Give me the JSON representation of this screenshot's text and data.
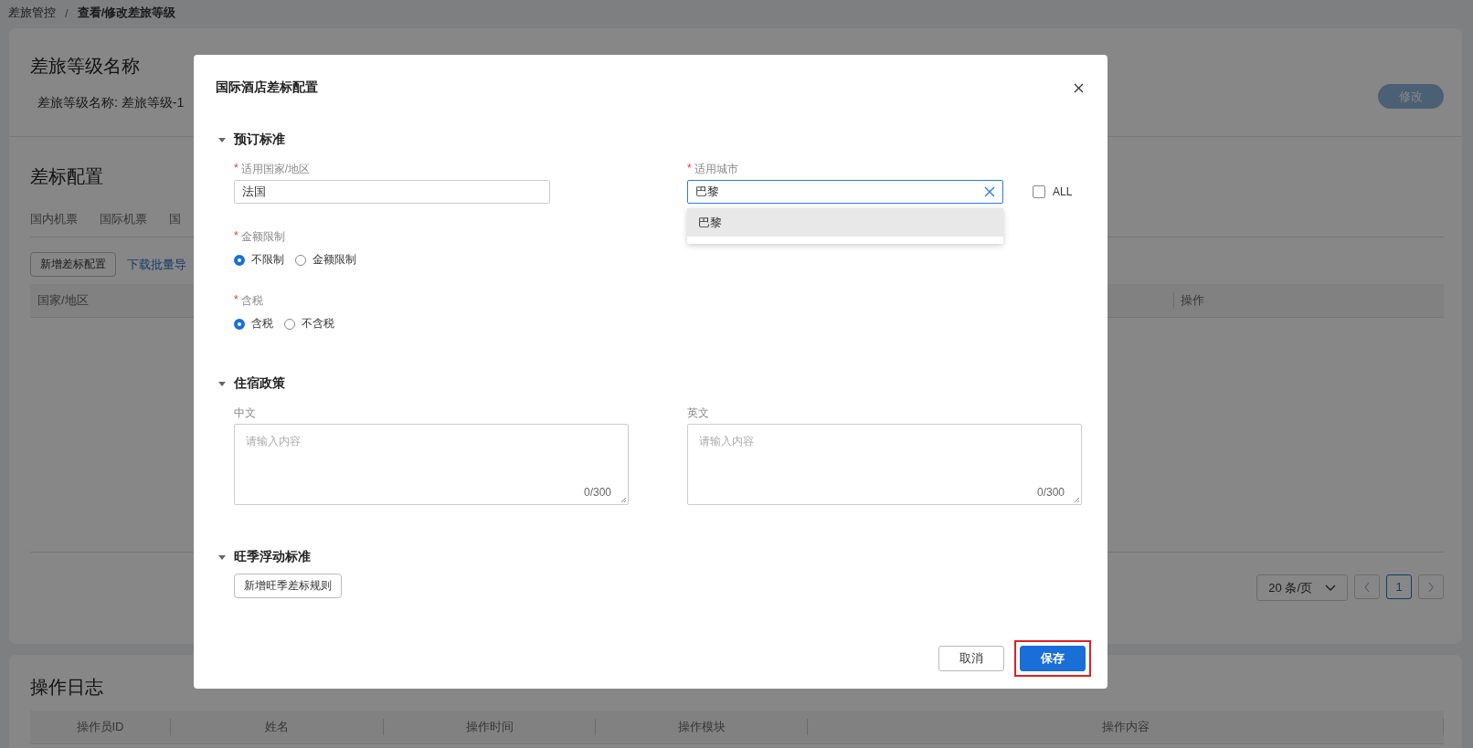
{
  "breadcrumb": {
    "items": [
      "差旅管控",
      "查看/修改差旅等级"
    ],
    "separator": "/"
  },
  "level_card": {
    "title": "差旅等级名称",
    "name_line": "差旅等级名称: 差旅等级-1",
    "edit_button": "修改"
  },
  "config": {
    "title": "差标配置",
    "tabs": [
      "国内机票",
      "国际机票",
      "国"
    ],
    "add_button": "新增差标配置",
    "import_link": "下载批量导",
    "table_columns": [
      "国家/地区",
      "操作"
    ],
    "pagination": {
      "page_size": "20 条/页",
      "pages": [
        {
          "label": "1",
          "selected": true
        }
      ]
    }
  },
  "log": {
    "title": "操作日志",
    "columns": [
      "操作员ID",
      "姓名",
      "操作时间",
      "操作模块",
      "操作内容"
    ]
  },
  "dialog": {
    "title": "国际酒店差标配置",
    "required_mark": "*",
    "sections": [
      {
        "title": "预订标准",
        "expanded": true,
        "fields": [
          {
            "kind": "select",
            "label": "适用国家/地区",
            "required": true,
            "value": "法国"
          },
          {
            "kind": "search",
            "label": "适用城市",
            "required": true,
            "value": "巴黎",
            "focused": true,
            "options": [
              {
                "label": "巴黎",
                "selected": true
              }
            ],
            "all_checkbox": {
              "label": "ALL",
              "checked": false
            }
          },
          {
            "kind": "radio",
            "label": "金额限制",
            "required": true,
            "options": [
              {
                "label": "不限制",
                "selected": true
              },
              {
                "label": "金额限制",
                "selected": false
              }
            ]
          },
          {
            "kind": "radio",
            "label": "含税",
            "required": true,
            "options": [
              {
                "label": "含税",
                "selected": true
              },
              {
                "label": "不含税",
                "selected": false
              }
            ]
          }
        ]
      },
      {
        "title": "住宿政策",
        "expanded": true,
        "fields": [
          {
            "kind": "textarea",
            "label": "中文",
            "placeholder": "请输入内容",
            "counter": "0/300"
          },
          {
            "kind": "textarea",
            "label": "英文",
            "placeholder": "请输入内容",
            "counter": "0/300"
          }
        ]
      },
      {
        "title": "旺季浮动标准",
        "expanded": true,
        "fields": [
          {
            "kind": "button",
            "label": "新增旺季差标规则"
          }
        ]
      }
    ],
    "buttons": [
      {
        "label": "取消",
        "kind": "default",
        "highlighted": false
      },
      {
        "label": "保存",
        "kind": "primary",
        "highlighted": true
      }
    ]
  }
}
